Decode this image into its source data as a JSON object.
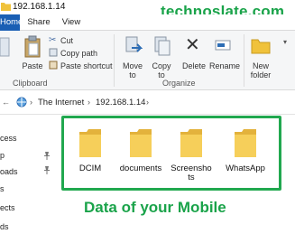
{
  "window": {
    "title": "192.168.1.14"
  },
  "watermark": {
    "brand": "technoslate.com"
  },
  "tabs": [
    {
      "label": "Home"
    },
    {
      "label": "Share"
    },
    {
      "label": "View"
    }
  ],
  "ribbon": {
    "clipboard": {
      "group_label": "Clipboard",
      "pin_label": "Pin to Quick access",
      "copy_label": "Copy",
      "paste_label": "Paste",
      "cut_label": "Cut",
      "copy_path_label": "Copy path",
      "paste_shortcut_label": "Paste shortcut"
    },
    "organize": {
      "group_label": "Organize",
      "move_to_label": "Move to",
      "copy_to_label": "Copy to",
      "delete_label": "Delete",
      "rename_label": "Rename"
    },
    "new": {
      "new_folder_label": "New folder"
    }
  },
  "address": {
    "segments": [
      "The Internet",
      "192.168.1.14"
    ]
  },
  "navpane": {
    "items": [
      "cess",
      "p",
      "oads",
      "s",
      "ects",
      "ds"
    ]
  },
  "folders": [
    {
      "name": "DCIM"
    },
    {
      "name": "documents"
    },
    {
      "name": "Screenshots"
    },
    {
      "name": "WhatsApp"
    }
  ],
  "caption": "Data of your Mobile",
  "colors": {
    "accent_green": "#1aa34a",
    "tab_blue": "#1a5fb4",
    "folder_yellow": "#f4c542"
  }
}
